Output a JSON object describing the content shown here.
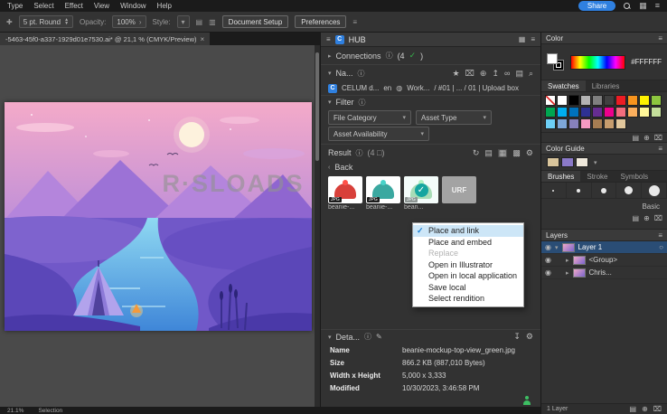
{
  "icons": {
    "info": "ⓘ",
    "star": "★",
    "trash": "⌧",
    "add": "⊕",
    "upload": "↥",
    "link": "∞",
    "folder": "▤",
    "search": "⌕",
    "refresh": "↻",
    "list_view": "▤",
    "grid_view": "▦",
    "grid_view2": "▩",
    "gear": "⚙",
    "pencil": "✎",
    "download": "↧",
    "check": "✓",
    "chev_right": "▸",
    "chev_down": "▾",
    "chev_small": "›",
    "back": "‹",
    "menu": "≡",
    "close": "×",
    "eye": "◉",
    "workspace": "▦",
    "globe": "◍",
    "dropdown": "▾",
    "target": "○"
  },
  "menubar": {
    "items": [
      "Type",
      "Select",
      "Effect",
      "View",
      "Window",
      "Help"
    ],
    "share": "Share"
  },
  "controlbar": {
    "stroke_value": "5 pt. Round",
    "opacity_label": "Opacity:",
    "opacity_value": "100%",
    "style_label": "Style:",
    "doc_setup": "Document Setup",
    "preferences": "Preferences"
  },
  "tabbar": {
    "title": "-5463-45f0-a337-1929d01e7530.ai* @ 21,1 % (CMYK/Preview)"
  },
  "canvas": {
    "watermark": "R·SLOADS"
  },
  "statusbar": {
    "zoom": "21.1%",
    "tool": "Selection"
  },
  "celum": {
    "logo": "C",
    "title": "HUB",
    "connections": {
      "label": "Connections",
      "count_prefix": "(4",
      "count_suffix": ")"
    },
    "nav": {
      "label": "Na..."
    },
    "breadcrumb": {
      "s1": "CELUM d...",
      "s2": "en",
      "s3": "Work...",
      "s4": "/ #01 | ... / 01 | Upload box"
    },
    "filter": {
      "label": "Filter",
      "file_category": "File Category",
      "asset_type": "Asset Type",
      "asset_availability": "Asset Availability"
    },
    "result": {
      "label": "Result",
      "count": "(4 □)"
    },
    "back": "Back",
    "thumbs": {
      "items": [
        {
          "label": "beanie-...",
          "badge": "JPG"
        },
        {
          "label": "beanie-...",
          "badge": "JPG"
        },
        {
          "label": "bean...",
          "badge": "JPG"
        },
        {
          "label": "",
          "badge": "",
          "text": "URF"
        }
      ]
    },
    "menu": {
      "items": [
        {
          "label": "Place and link"
        },
        {
          "label": "Place and embed"
        },
        {
          "label": "Replace"
        },
        {
          "label": "Open in Illustrator"
        },
        {
          "label": "Open in local application"
        },
        {
          "label": "Save local"
        },
        {
          "label": "Select rendition"
        }
      ]
    },
    "detail": {
      "label": "Deta...",
      "rows": [
        {
          "key": "Name",
          "value": "beanie-mockup-top-view_green.jpg"
        },
        {
          "key": "Size",
          "value": "866.2 KB (887,010 Bytes)"
        },
        {
          "key": "Width x Height",
          "value": "5,000 x 3,333"
        },
        {
          "key": "Modified",
          "value": "10/30/2023, 3:46:58 PM"
        }
      ]
    }
  },
  "panels": {
    "color": {
      "title": "Color",
      "hex": "#FFFFFF"
    },
    "swatches": {
      "tab1": "Swatches",
      "tab2": "Libraries",
      "colors": [
        "none",
        "#ffffff",
        "#000000",
        "#b3b3b3",
        "#7f7f7f",
        "#404040",
        "#ed1c24",
        "#f7941d",
        "#fff200",
        "#8dc63f",
        "#00a651",
        "#00aeef",
        "#0072bc",
        "#2e3192",
        "#662d91",
        "#ec008c",
        "#f26d7d",
        "#fbaf5d",
        "#fff799",
        "#c4df9b",
        "#6dcff6",
        "#7da7d9",
        "#8781bd",
        "#f49ac1",
        "#a67c52",
        "#c69c6d",
        "#e2c79c"
      ]
    },
    "color_guide": {
      "title": "Color Guide"
    },
    "brushes": {
      "tab1": "Brushes",
      "tab2": "Stroke",
      "tab3": "Symbols",
      "basic": "Basic",
      "dots": [
        2,
        4,
        6,
        9,
        12
      ]
    },
    "layers": {
      "title": "Layers",
      "rows": [
        {
          "name": "Layer 1"
        },
        {
          "name": "<Group>"
        },
        {
          "name": "Chris..."
        }
      ],
      "status": "1 Layer"
    }
  },
  "colors": {
    "accent": "#2f80e0",
    "selection": "#2a4d75",
    "check_green": "#35b24a"
  }
}
